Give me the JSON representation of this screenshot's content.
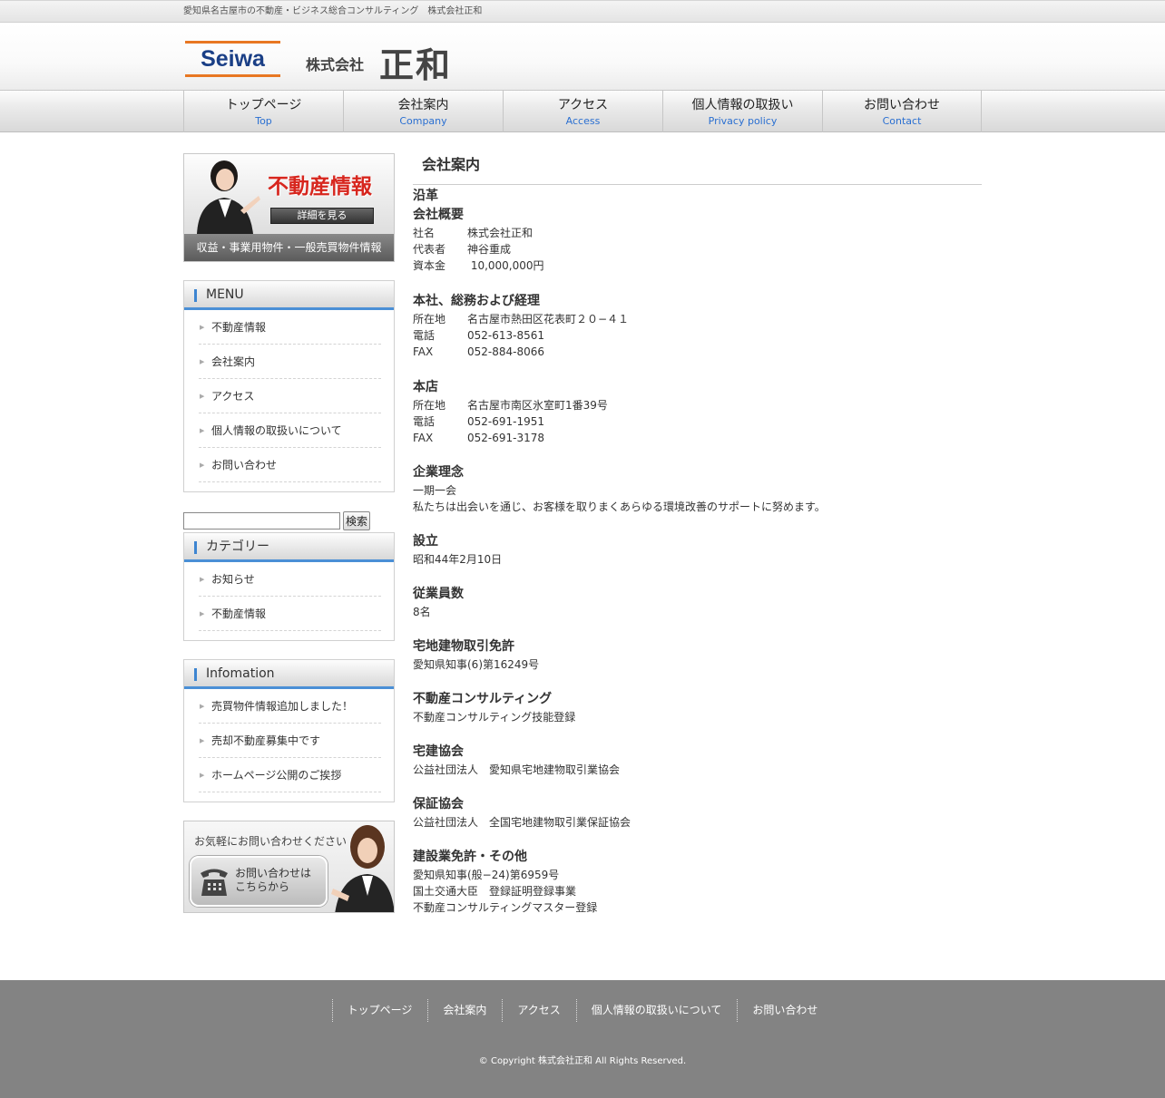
{
  "topbar": {
    "tagline": "愛知県名古屋市の不動産・ビジネス総合コンサルティング　株式会社正和"
  },
  "header": {
    "logo_text": "Seiwa",
    "brand_small": "株式会社",
    "brand_big": "正和"
  },
  "gnav": [
    {
      "jp": "トップページ",
      "en": "Top"
    },
    {
      "jp": "会社案内",
      "en": "Company"
    },
    {
      "jp": "アクセス",
      "en": "Access"
    },
    {
      "jp": "個人情報の取扱い",
      "en": "Privacy policy"
    },
    {
      "jp": "お問い合わせ",
      "en": "Contact"
    }
  ],
  "banner_fudosan": {
    "title": "不動産情報",
    "button": "詳細を見る",
    "subtitle": "収益・事業用物件・一般売買物件情報"
  },
  "menu": {
    "title": "MENU",
    "items": [
      "不動産情報",
      "会社案内",
      "アクセス",
      "個人情報の取扱いについて",
      "お問い合わせ"
    ]
  },
  "search": {
    "value": "",
    "button": "検索"
  },
  "category": {
    "title": "カテゴリー",
    "items": [
      "お知らせ",
      "不動産情報"
    ]
  },
  "info": {
    "title": "Infomation",
    "items": [
      "売買物件情報追加しました！",
      "売却不動産募集中です",
      "ホームページ公開のご挨拶"
    ]
  },
  "banner_contact": {
    "lead": "お気軽にお問い合わせください",
    "line1": "お問い合わせは",
    "line2": "こちらから"
  },
  "main": {
    "page_title": "会社案内",
    "enkaku": "沿革",
    "gaiyo": {
      "title": "会社概要",
      "rows": [
        {
          "k": "社名",
          "v": "株式会社正和"
        },
        {
          "k": "代表者",
          "v": "神谷重成"
        },
        {
          "k": "資本金",
          "v": " 10,000,000円"
        }
      ]
    },
    "honsha": {
      "title": "本社、総務および経理",
      "rows": [
        {
          "k": "所在地",
          "v": "名古屋市熱田区花表町２０−４１"
        },
        {
          "k": "電話",
          "v": "052-613-8561"
        },
        {
          "k": "FAX",
          "v": "052-884-8066"
        }
      ]
    },
    "honten": {
      "title": "本店",
      "rows": [
        {
          "k": "所在地",
          "v": "名古屋市南区氷室町1番39号"
        },
        {
          "k": "電話",
          "v": "052-691-1951"
        },
        {
          "k": "FAX",
          "v": "052-691-3178"
        }
      ]
    },
    "rinen": {
      "title": "企業理念",
      "lines": [
        "一期一会",
        "私たちは出会いを通じ、お客様を取りまくあらゆる環境改善のサポートに努めます。"
      ]
    },
    "setsuritsu": {
      "title": "設立",
      "lines": [
        "昭和44年2月10日"
      ]
    },
    "jugyoin": {
      "title": "従業員数",
      "lines": [
        "8名"
      ]
    },
    "takuchi": {
      "title": "宅地建物取引免許",
      "lines": [
        "愛知県知事(6)第16249号"
      ]
    },
    "consul": {
      "title": "不動産コンサルティング",
      "lines": [
        "不動産コンサルティング技能登録"
      ]
    },
    "takken": {
      "title": "宅建協会",
      "lines": [
        "公益社団法人　愛知県宅地建物取引業協会"
      ]
    },
    "hosho": {
      "title": "保証協会",
      "lines": [
        "公益社団法人　全国宅地建物取引業保証協会"
      ]
    },
    "kensetsu": {
      "title": "建設業免許・その他",
      "lines": [
        "愛知県知事(般−24)第6959号",
        "国土交通大臣　登録証明登録事業",
        "不動産コンサルティングマスター登録"
      ]
    }
  },
  "footer": {
    "links": [
      "トップページ",
      "会社案内",
      "アクセス",
      "個人情報の取扱いについて",
      "お問い合わせ"
    ],
    "copyright": "© Copyright 株式会社正和 All Rights Reserved."
  },
  "colors": {
    "accent": "#4a8fd6",
    "nav_en": "#2a6fd1",
    "banner_red": "#d7261e",
    "footer_bg": "#838383"
  }
}
